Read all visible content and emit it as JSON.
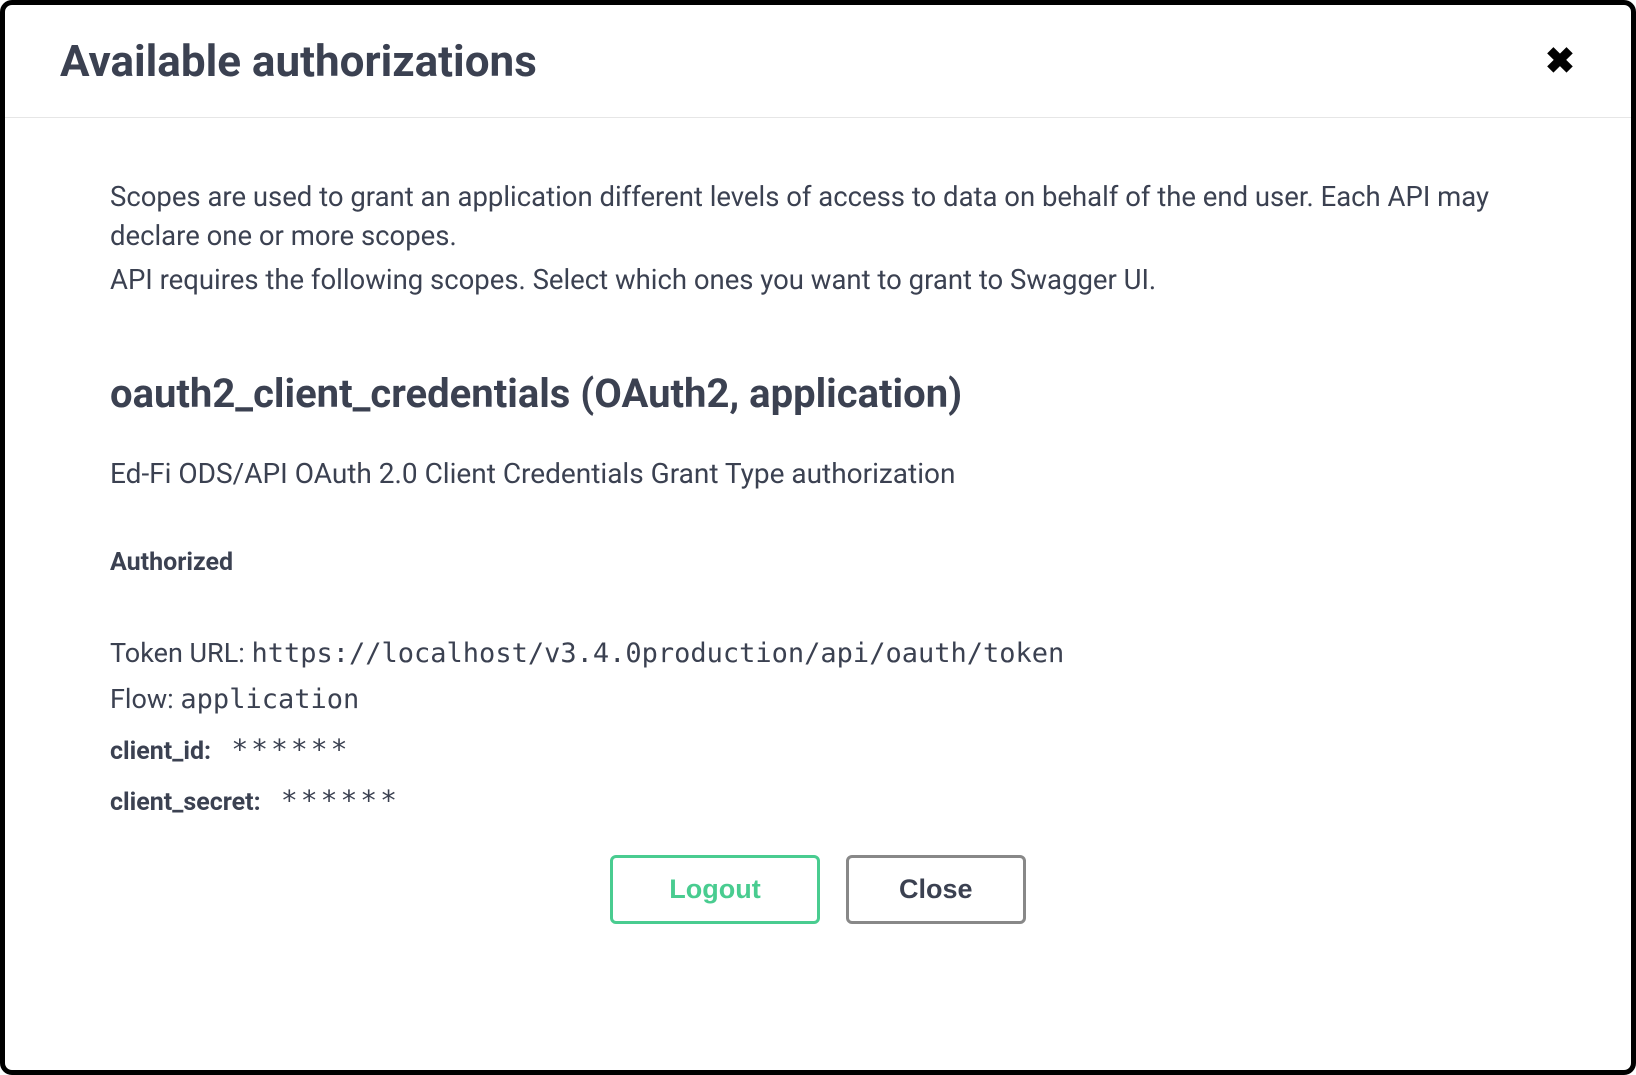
{
  "header": {
    "title": "Available authorizations"
  },
  "intro": {
    "line1": "Scopes are used to grant an application different levels of access to data on behalf of the end user. Each API may declare one or more scopes.",
    "line2": "API requires the following scopes. Select which ones you want to grant to Swagger UI."
  },
  "scheme": {
    "title": "oauth2_client_credentials (OAuth2, application)",
    "description": "Ed-Fi ODS/API OAuth 2.0 Client Credentials Grant Type authorization",
    "status": "Authorized",
    "token_url_label": "Token URL:",
    "token_url": "https://localhost/v3.4.0production/api/oauth/token",
    "flow_label": "Flow:",
    "flow": "application",
    "client_id_label": "client_id:",
    "client_id_value": "******",
    "client_secret_label": "client_secret:",
    "client_secret_value": "******"
  },
  "buttons": {
    "logout": "Logout",
    "close": "Close"
  }
}
